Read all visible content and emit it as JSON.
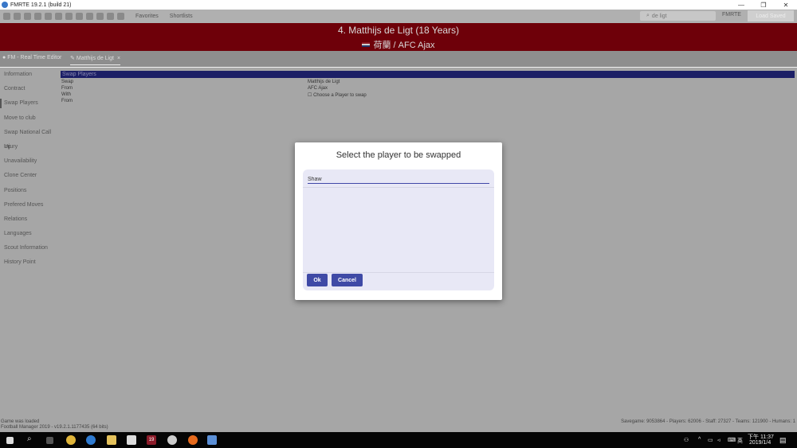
{
  "window": {
    "title": "FMRTE 19.2.1 (build 21)",
    "minimize": "—",
    "maximize": "❐",
    "close": "✕"
  },
  "toolbar": {
    "favorites": "Favorites",
    "shortlists": "Shortlists",
    "search_value": "de ligt",
    "fmrte": "FMRTE",
    "load_save": "Load Saved"
  },
  "player": {
    "header": "4. Matthijs de Ligt (18 Years)",
    "nation_club": "荷蘭 / AFC Ajax"
  },
  "tabs": [
    {
      "label": "FM - Real Time Editor"
    },
    {
      "label": "Matthijs de Ligt",
      "close": "×"
    }
  ],
  "sidebar": {
    "items": [
      "Information",
      "Contract",
      "Swap Players",
      "Move to club",
      "Swap National Call Up",
      "Injury",
      "Unavailability",
      "Clone Center",
      "Positions",
      "Prefered Moves",
      "Relations",
      "Languages",
      "Scout Information",
      "History Point"
    ],
    "active": "Swap Players"
  },
  "swap_section": {
    "title": "Swap Players",
    "rows": [
      {
        "label": "Swap",
        "value": "Matthijs de Ligt"
      },
      {
        "label": "From",
        "value": "AFC Ajax"
      },
      {
        "label": "With",
        "value": "Choose a Player to swap"
      },
      {
        "label": "From",
        "value": ""
      }
    ]
  },
  "dialog": {
    "title": "Select the player to be swapped",
    "input_value": "Shaw",
    "ok": "Ok",
    "cancel": "Cancel"
  },
  "status": {
    "line1": "Game was loaded",
    "line2": "Football Manager 2019 - v19.2.1.1177435 (64 bits)",
    "right": "Savegame: 9053864 - Players: 62006 - Staff: 27327 - Teams: 121900 - Humans: 1"
  },
  "taskbar": {
    "time": "下午 11:37",
    "date": "2019/1/4",
    "lang": "英",
    "chrome_badge": "19"
  },
  "colors": {
    "accent": "#3f4aa6",
    "banner": "#6e0009",
    "section_head": "#1c1f66"
  }
}
